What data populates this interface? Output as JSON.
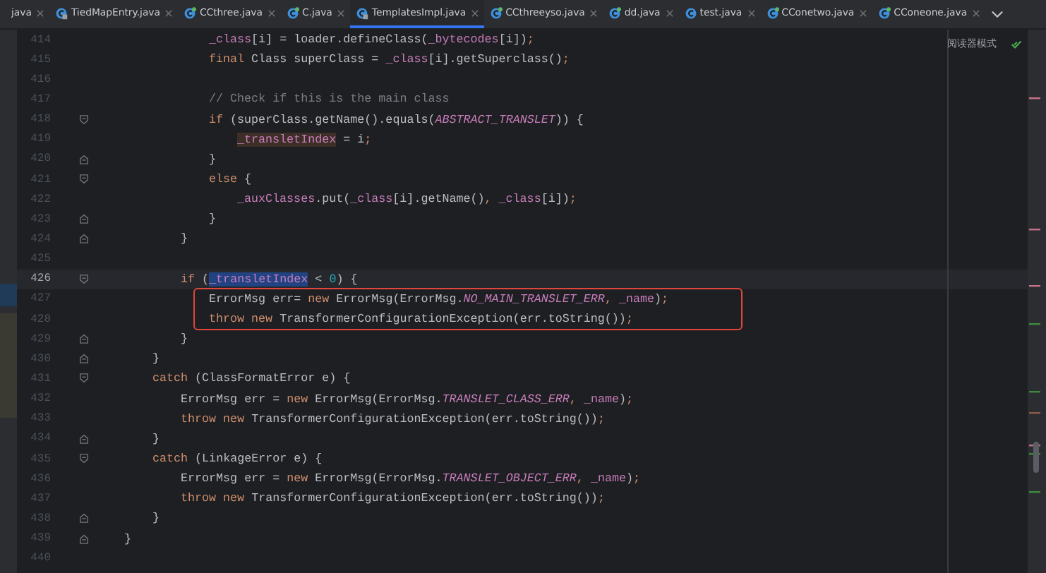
{
  "tabs": [
    {
      "label": "java",
      "selected": false
    },
    {
      "label": "TiedMapEntry.java",
      "kind": "library",
      "selected": false
    },
    {
      "label": "CCthree.java",
      "kind": "source",
      "selected": false
    },
    {
      "label": "C.java",
      "kind": "source",
      "selected": false
    },
    {
      "label": "TemplatesImpl.java",
      "kind": "library",
      "selected": true
    },
    {
      "label": "CCthreeyso.java",
      "kind": "source",
      "selected": false
    },
    {
      "label": "dd.java",
      "kind": "source",
      "selected": false
    },
    {
      "label": "test.java",
      "kind": "plain",
      "selected": false
    },
    {
      "label": "CConetwo.java",
      "kind": "source",
      "selected": false
    },
    {
      "label": "CConeone.java",
      "kind": "source",
      "selected": false
    }
  ],
  "reader_mode": {
    "label": "阅读器模式"
  },
  "editor": {
    "lines": [
      {
        "number": "414",
        "fold_start": false,
        "fold_end": false,
        "current": false,
        "boxed": false,
        "tokens": [
          {
            "text": "_class",
            "kind": "field"
          },
          {
            "text": "[i] = loader.defineClass(",
            "kind": "plain"
          },
          {
            "text": "_bytecodes",
            "kind": "field"
          },
          {
            "text": "[i])",
            "kind": "plain"
          },
          {
            "text": ";",
            "kind": "punct"
          }
        ]
      },
      {
        "number": "415",
        "fold_start": false,
        "fold_end": false,
        "current": false,
        "boxed": false,
        "tokens": [
          {
            "text": "final ",
            "kind": "keyword"
          },
          {
            "text": "Class superClass = ",
            "kind": "plain"
          },
          {
            "text": "_class",
            "kind": "field"
          },
          {
            "text": "[i].getSuperclass()",
            "kind": "plain"
          },
          {
            "text": ";",
            "kind": "punct"
          }
        ]
      },
      {
        "number": "416",
        "fold_start": false,
        "fold_end": false,
        "current": false,
        "boxed": false
      },
      {
        "number": "417",
        "fold_start": false,
        "fold_end": false,
        "current": false,
        "boxed": false,
        "tokens": [
          {
            "text": "// Check if this is the main class",
            "kind": "comment"
          }
        ]
      },
      {
        "number": "418",
        "fold_start": true,
        "fold_end": false,
        "current": false,
        "boxed": false,
        "tokens": [
          {
            "text": "if ",
            "kind": "keyword"
          },
          {
            "text": "(superClass.getName().equals(",
            "kind": "plain"
          },
          {
            "text": "ABSTRACT_TRANSLET",
            "kind": "constant"
          },
          {
            "text": ")) {",
            "kind": "plain"
          }
        ]
      },
      {
        "number": "419",
        "fold_start": false,
        "fold_end": false,
        "current": false,
        "boxed": false,
        "tokens": [
          {
            "text": "_transletIndex",
            "kind": "field-write"
          },
          {
            "text": " = i",
            "kind": "plain"
          },
          {
            "text": ";",
            "kind": "punct"
          }
        ]
      },
      {
        "number": "420",
        "fold_start": false,
        "fold_end": true,
        "current": false,
        "boxed": false,
        "tokens": [
          {
            "text": "}",
            "kind": "plain"
          }
        ]
      },
      {
        "number": "421",
        "fold_start": true,
        "fold_end": false,
        "current": false,
        "boxed": false,
        "tokens": [
          {
            "text": "else ",
            "kind": "keyword"
          },
          {
            "text": "{",
            "kind": "plain"
          }
        ]
      },
      {
        "number": "422",
        "fold_start": false,
        "fold_end": false,
        "current": false,
        "boxed": false,
        "tokens": [
          {
            "text": "_auxClasses",
            "kind": "field"
          },
          {
            "text": ".put(",
            "kind": "plain"
          },
          {
            "text": "_class",
            "kind": "field"
          },
          {
            "text": "[i].getName()",
            "kind": "plain"
          },
          {
            "text": ", ",
            "kind": "punct"
          },
          {
            "text": "_class",
            "kind": "field"
          },
          {
            "text": "[i])",
            "kind": "plain"
          },
          {
            "text": ";",
            "kind": "punct"
          }
        ]
      },
      {
        "number": "423",
        "fold_start": false,
        "fold_end": true,
        "current": false,
        "boxed": false,
        "tokens": [
          {
            "text": "}",
            "kind": "plain"
          }
        ]
      },
      {
        "number": "424",
        "fold_start": false,
        "fold_end": true,
        "current": false,
        "boxed": false,
        "tokens": [
          {
            "text": "}",
            "kind": "plain"
          }
        ]
      },
      {
        "number": "425",
        "fold_start": false,
        "fold_end": false,
        "current": false,
        "boxed": false
      },
      {
        "number": "426",
        "fold_start": true,
        "fold_end": false,
        "current": true,
        "boxed": false,
        "tokens": [
          {
            "text": "if ",
            "kind": "keyword"
          },
          {
            "text": "(",
            "kind": "plain"
          },
          {
            "text": "_transletIndex",
            "kind": "field-selected"
          },
          {
            "text": " < ",
            "kind": "plain"
          },
          {
            "text": "0",
            "kind": "number"
          },
          {
            "text": ") {",
            "kind": "plain"
          }
        ]
      },
      {
        "number": "427",
        "fold_start": false,
        "fold_end": false,
        "current": false,
        "boxed": true,
        "tokens": [
          {
            "text": "ErrorMsg err= ",
            "kind": "plain"
          },
          {
            "text": "new ",
            "kind": "keyword"
          },
          {
            "text": "ErrorMsg(ErrorMsg.",
            "kind": "plain"
          },
          {
            "text": "NO_MAIN_TRANSLET_ERR",
            "kind": "constant"
          },
          {
            "text": ", ",
            "kind": "punct"
          },
          {
            "text": "_name",
            "kind": "field"
          },
          {
            "text": ")",
            "kind": "plain"
          },
          {
            "text": ";",
            "kind": "punct"
          }
        ]
      },
      {
        "number": "428",
        "fold_start": false,
        "fold_end": false,
        "current": false,
        "boxed": true,
        "tokens": [
          {
            "text": "throw new ",
            "kind": "keyword"
          },
          {
            "text": "TransformerConfigurationException(err.toString())",
            "kind": "plain"
          },
          {
            "text": ";",
            "kind": "punct"
          }
        ]
      },
      {
        "number": "429",
        "fold_start": false,
        "fold_end": true,
        "current": false,
        "boxed": false,
        "tokens": [
          {
            "text": "}",
            "kind": "plain"
          }
        ]
      },
      {
        "number": "430",
        "fold_start": false,
        "fold_end": true,
        "current": false,
        "boxed": false,
        "tokens": [
          {
            "text": "}",
            "kind": "plain"
          }
        ]
      },
      {
        "number": "431",
        "fold_start": true,
        "fold_end": false,
        "current": false,
        "boxed": false,
        "tokens": [
          {
            "text": "catch ",
            "kind": "keyword"
          },
          {
            "text": "(ClassFormatError e) {",
            "kind": "plain"
          }
        ]
      },
      {
        "number": "432",
        "fold_start": false,
        "fold_end": false,
        "current": false,
        "boxed": false,
        "tokens": [
          {
            "text": "ErrorMsg err = ",
            "kind": "plain"
          },
          {
            "text": "new ",
            "kind": "keyword"
          },
          {
            "text": "ErrorMsg(ErrorMsg.",
            "kind": "plain"
          },
          {
            "text": "TRANSLET_CLASS_ERR",
            "kind": "constant"
          },
          {
            "text": ", ",
            "kind": "punct"
          },
          {
            "text": "_name",
            "kind": "field"
          },
          {
            "text": ")",
            "kind": "plain"
          },
          {
            "text": ";",
            "kind": "punct"
          }
        ]
      },
      {
        "number": "433",
        "fold_start": false,
        "fold_end": false,
        "current": false,
        "boxed": false,
        "tokens": [
          {
            "text": "throw new ",
            "kind": "keyword"
          },
          {
            "text": "TransformerConfigurationException(err.toString())",
            "kind": "plain"
          },
          {
            "text": ";",
            "kind": "punct"
          }
        ]
      },
      {
        "number": "434",
        "fold_start": false,
        "fold_end": true,
        "current": false,
        "boxed": false,
        "tokens": [
          {
            "text": "}",
            "kind": "plain"
          }
        ]
      },
      {
        "number": "435",
        "fold_start": true,
        "fold_end": false,
        "current": false,
        "boxed": false,
        "tokens": [
          {
            "text": "catch ",
            "kind": "keyword"
          },
          {
            "text": "(LinkageError e) {",
            "kind": "plain"
          }
        ]
      },
      {
        "number": "436",
        "fold_start": false,
        "fold_end": false,
        "current": false,
        "boxed": false,
        "tokens": [
          {
            "text": "ErrorMsg err = ",
            "kind": "plain"
          },
          {
            "text": "new ",
            "kind": "keyword"
          },
          {
            "text": "ErrorMsg(ErrorMsg.",
            "kind": "plain"
          },
          {
            "text": "TRANSLET_OBJECT_ERR",
            "kind": "constant"
          },
          {
            "text": ", ",
            "kind": "punct"
          },
          {
            "text": "_name",
            "kind": "field"
          },
          {
            "text": ")",
            "kind": "plain"
          },
          {
            "text": ";",
            "kind": "punct"
          }
        ]
      },
      {
        "number": "437",
        "fold_start": false,
        "fold_end": false,
        "current": false,
        "boxed": false,
        "tokens": [
          {
            "text": "throw new ",
            "kind": "keyword"
          },
          {
            "text": "TransformerConfigurationException(err.toString())",
            "kind": "plain"
          },
          {
            "text": ";",
            "kind": "punct"
          }
        ]
      },
      {
        "number": "438",
        "fold_start": false,
        "fold_end": true,
        "current": false,
        "boxed": false,
        "tokens": [
          {
            "text": "}",
            "kind": "plain"
          }
        ]
      },
      {
        "number": "439",
        "fold_start": false,
        "fold_end": true,
        "current": false,
        "boxed": false,
        "tokens": [
          {
            "text": "}",
            "kind": "plain"
          }
        ]
      },
      {
        "number": "440",
        "fold_start": false,
        "fold_end": false,
        "current": false,
        "boxed": false
      }
    ]
  }
}
